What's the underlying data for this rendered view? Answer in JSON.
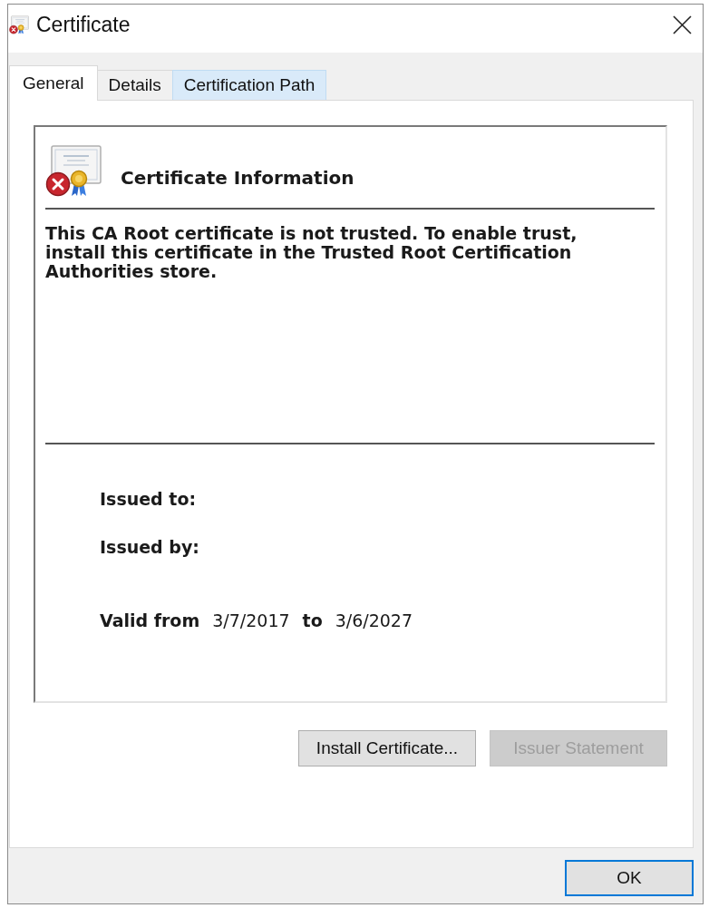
{
  "window": {
    "title": "Certificate"
  },
  "tabs": [
    {
      "label": "General",
      "selected": true,
      "hovered": false
    },
    {
      "label": "Details",
      "selected": false,
      "hovered": false
    },
    {
      "label": "Certification Path",
      "selected": false,
      "hovered": true
    }
  ],
  "info": {
    "heading": "Certificate Information",
    "message": "This CA Root certificate is not trusted. To enable trust, install this certificate in the Trusted Root Certification Authorities store."
  },
  "details": {
    "issued_to_label": "Issued to:",
    "issued_by_label": "Issued by:",
    "valid_from_label": "Valid from",
    "valid_from": "3/7/2017",
    "to_label": "to",
    "valid_to": "3/6/2027"
  },
  "buttons": [
    {
      "label": "Install Certificate...",
      "disabled": false
    },
    {
      "label": "Issuer Statement",
      "disabled": true
    }
  ],
  "footer_buttons": [
    {
      "label": "OK",
      "default": true
    }
  ]
}
